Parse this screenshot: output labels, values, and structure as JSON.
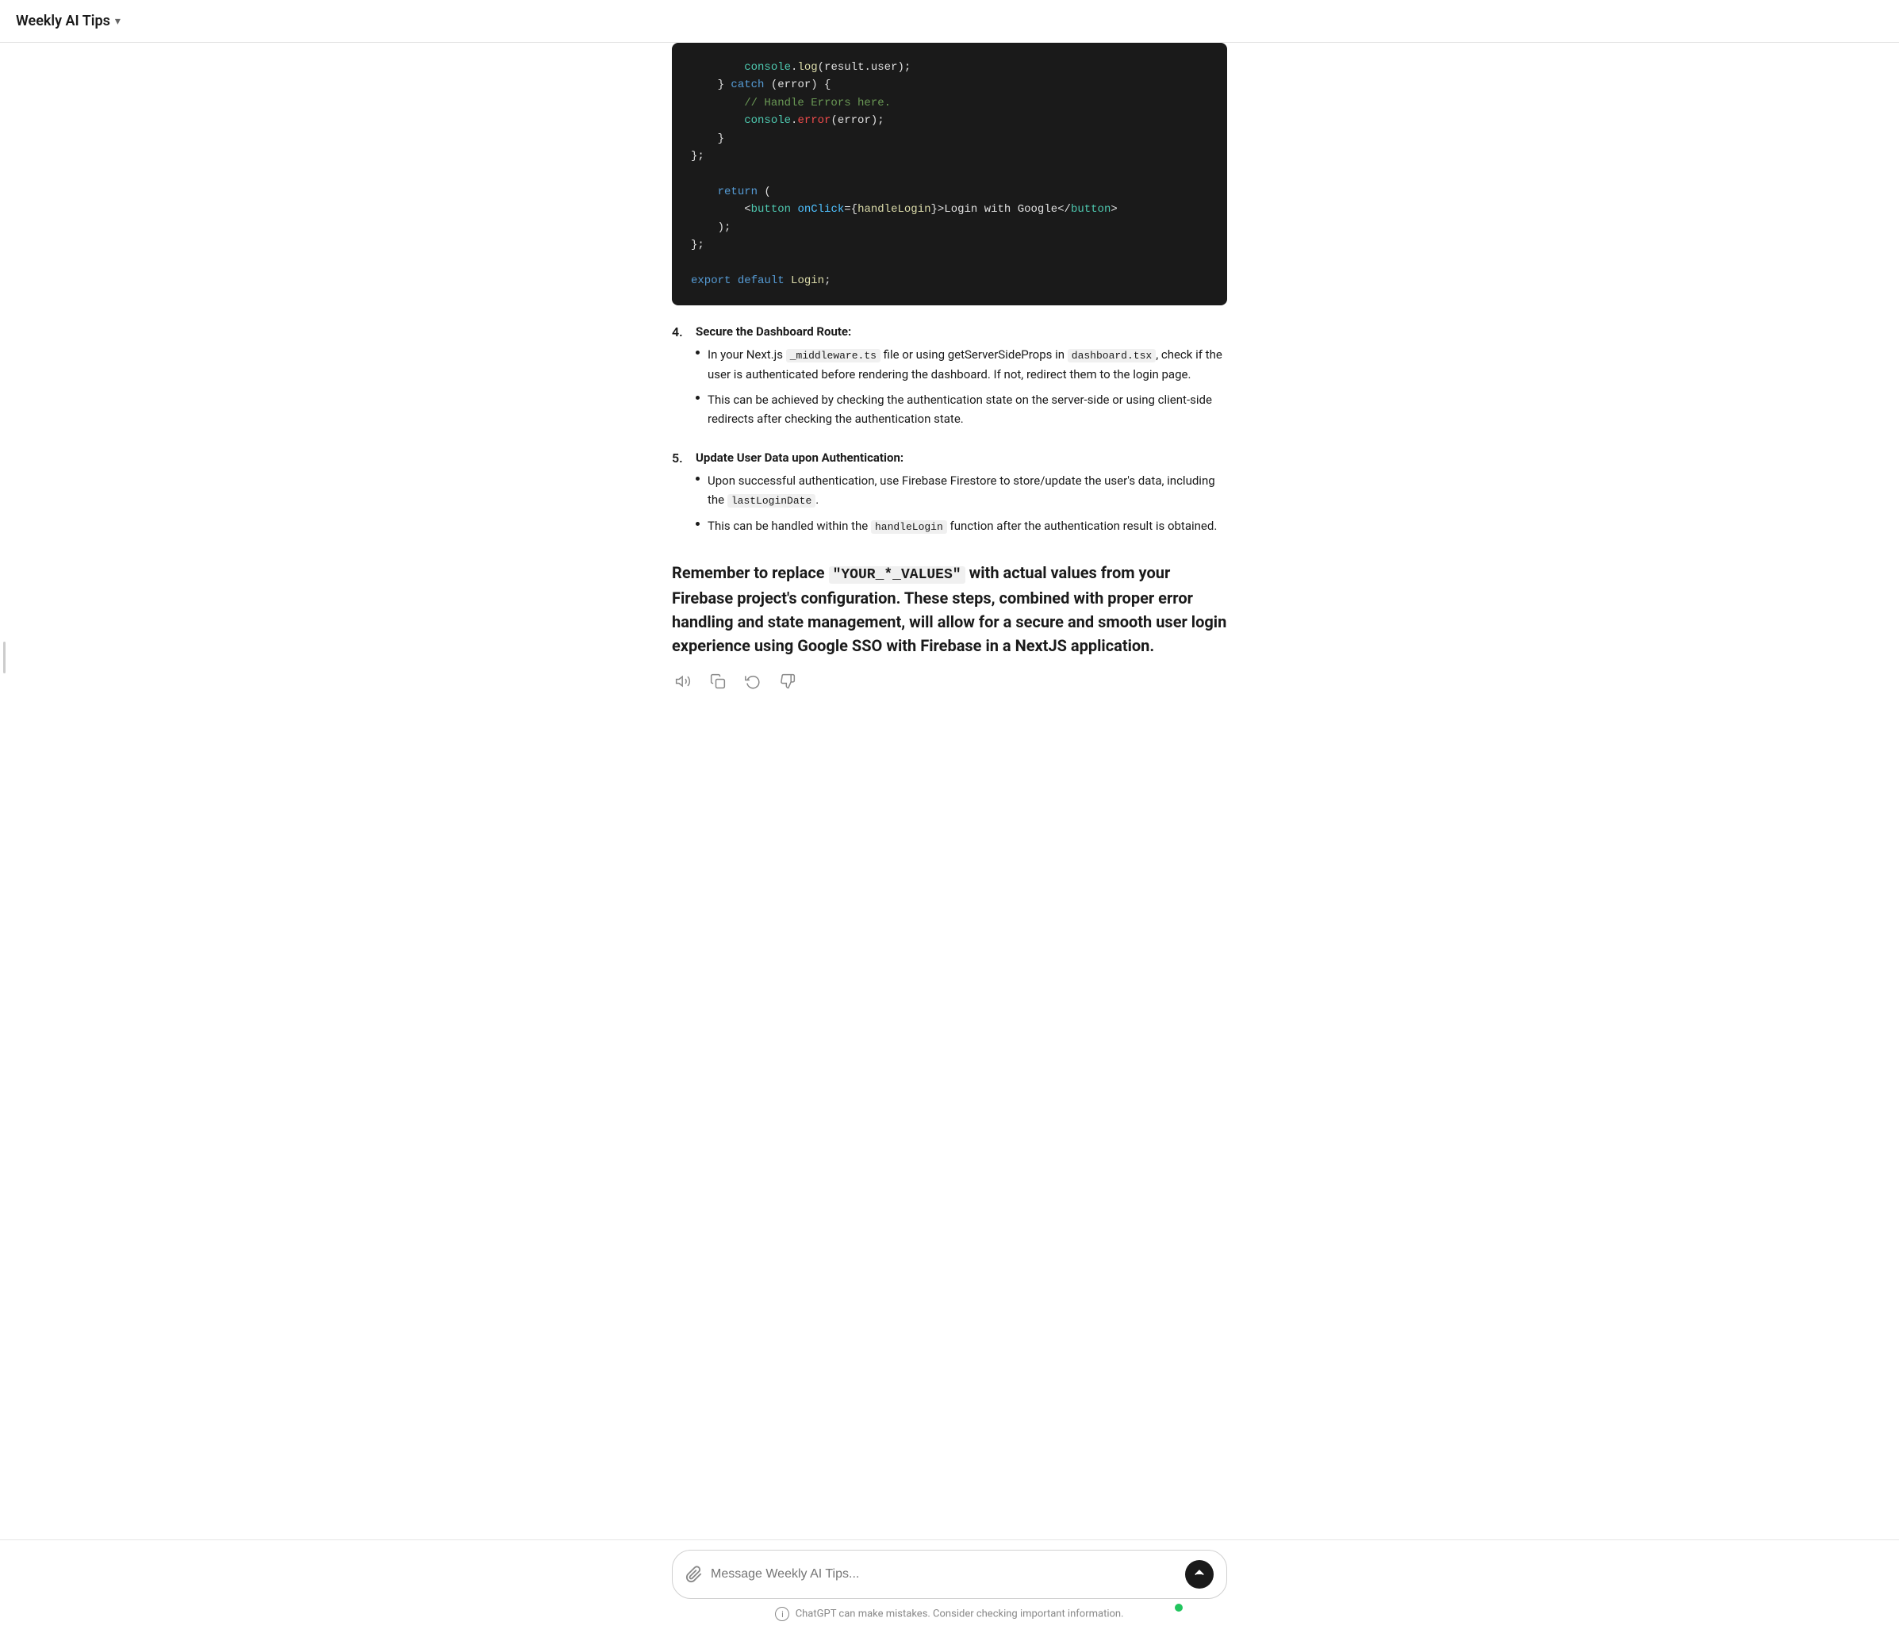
{
  "header": {
    "title": "Weekly AI Tips",
    "chevron": "▾"
  },
  "code_block": {
    "lines": [
      {
        "text": "        console",
        "color": "c-cyan"
      },
      {
        "text": ".log(result.user);",
        "color": "c-white"
      },
      {
        "text": "    } catch (error) {",
        "color": "c-white"
      },
      {
        "text": "        // Handle Errors here.",
        "color": "c-gray"
      },
      {
        "text": "        console",
        "color": "c-cyan"
      },
      {
        "text": ".error(error);",
        "color": "c-white"
      },
      {
        "text": "    }",
        "color": "c-white"
      },
      {
        "text": "};",
        "color": "c-white"
      },
      {
        "text": "",
        "color": "c-white"
      },
      {
        "text": "    return (",
        "color": "c-white"
      },
      {
        "text": "        <button onClick={handleLogin}>Login with Google</button>",
        "color": "c-white"
      },
      {
        "text": "    );",
        "color": "c-white"
      },
      {
        "text": "};",
        "color": "c-white"
      },
      {
        "text": "",
        "color": "c-white"
      },
      {
        "text": "export default Login;",
        "color": "c-white"
      }
    ]
  },
  "sections": [
    {
      "number": "4.",
      "title": "Secure the Dashboard Route:",
      "bullets": [
        {
          "text_parts": [
            {
              "text": "In your Next.js ",
              "type": "normal"
            },
            {
              "text": "`_middleware.ts`",
              "type": "code"
            },
            {
              "text": " file or using getServerSideProps in ",
              "type": "normal"
            },
            {
              "text": "`dashboard.tsx`",
              "type": "code"
            },
            {
              "text": ", check if the user is authenticated before rendering the dashboard. If not, redirect them to the login page.",
              "type": "normal"
            }
          ]
        },
        {
          "text_parts": [
            {
              "text": "This can be achieved by checking the authentication state on the server-side or using client-side redirects after checking the authentication state.",
              "type": "normal"
            }
          ]
        }
      ]
    },
    {
      "number": "5.",
      "title": "Update User Data upon Authentication:",
      "bullets": [
        {
          "text_parts": [
            {
              "text": "Upon successful authentication, use Firebase Firestore to store/update the user's data, including the ",
              "type": "normal"
            },
            {
              "text": "`lastLoginDate`",
              "type": "code"
            },
            {
              "text": ".",
              "type": "normal"
            }
          ]
        },
        {
          "text_parts": [
            {
              "text": "This can be handled within the ",
              "type": "normal"
            },
            {
              "text": "`handleLogin`",
              "type": "code"
            },
            {
              "text": " function after the authentication result is obtained.",
              "type": "normal"
            }
          ]
        }
      ]
    }
  ],
  "summary": {
    "text": "Remember to replace ",
    "code": "\"YOUR_*_VALUES\"",
    "text2": " with actual values from your Firebase project's configuration. These steps, combined with proper error handling and state management, will allow for a secure and smooth user login experience using Google SSO with Firebase in a NextJS application."
  },
  "action_icons": {
    "speaker": "🔊",
    "copy": "⊡",
    "refresh": "↺",
    "thumbs_down": "👎"
  },
  "input": {
    "placeholder": "Message Weekly AI Tips...",
    "attach_icon": "⊕",
    "send_icon": "↑"
  },
  "disclaimer": "ChatGPT can make mistakes. Consider checking important information."
}
